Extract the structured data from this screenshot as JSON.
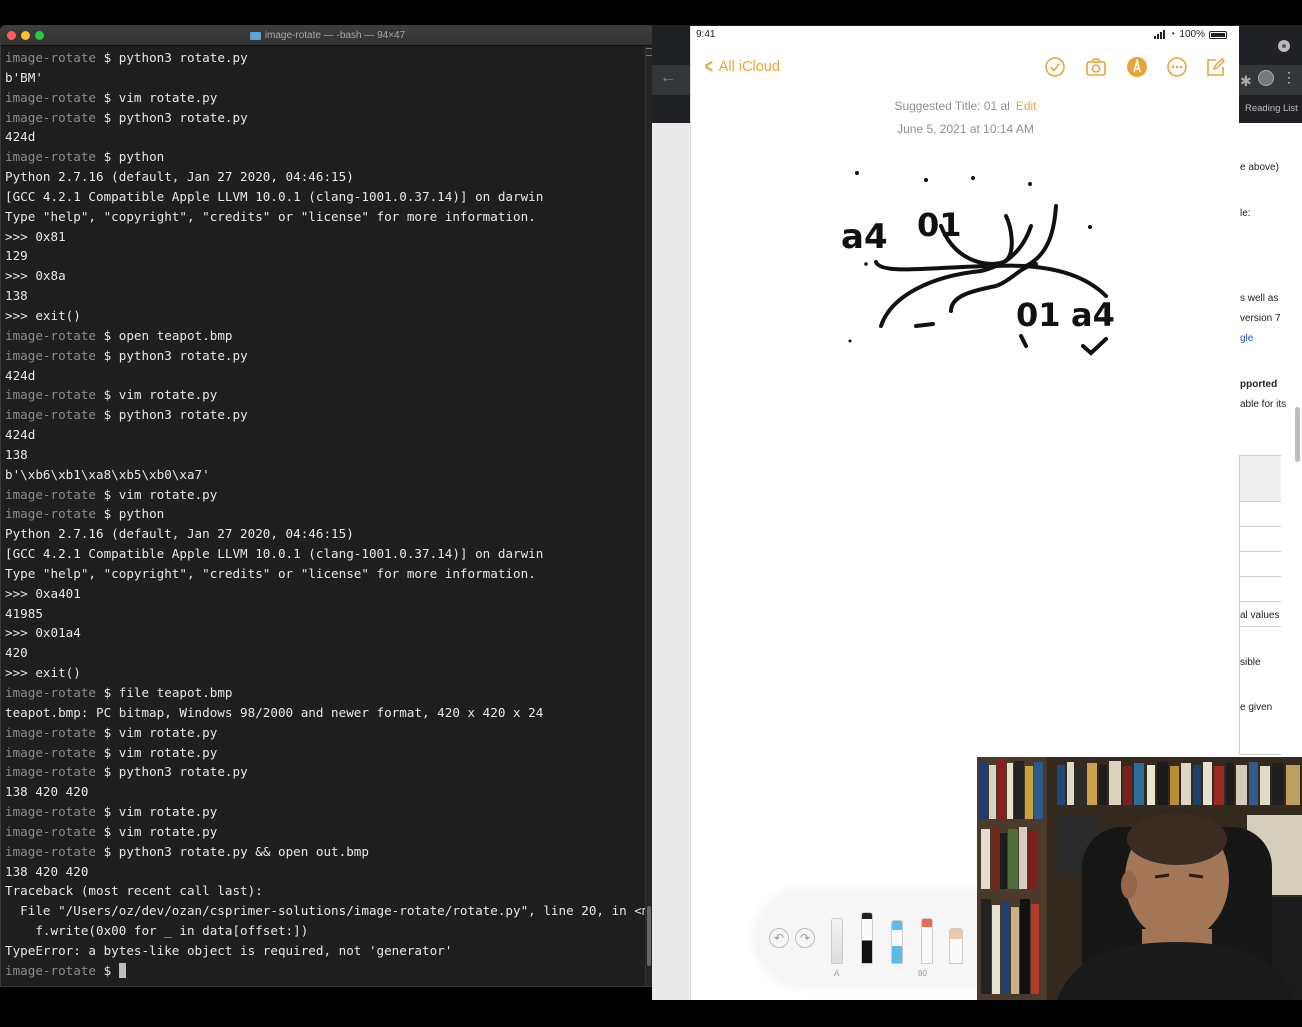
{
  "terminal": {
    "title": "image-rotate — -bash — 94×47",
    "lines": [
      {
        "p": "image-rotate",
        "c": "$ python3 rotate.py"
      },
      {
        "o": "b'BM'"
      },
      {
        "p": "image-rotate",
        "c": "$ vim rotate.py"
      },
      {
        "p": "image-rotate",
        "c": "$ python3 rotate.py"
      },
      {
        "o": "424d"
      },
      {
        "p": "image-rotate",
        "c": "$ python"
      },
      {
        "o": "Python 2.7.16 (default, Jan 27 2020, 04:46:15)"
      },
      {
        "o": "[GCC 4.2.1 Compatible Apple LLVM 10.0.1 (clang-1001.0.37.14)] on darwin"
      },
      {
        "o": "Type \"help\", \"copyright\", \"credits\" or \"license\" for more information."
      },
      {
        "o": ">>> 0x81"
      },
      {
        "o": "129"
      },
      {
        "o": ">>> 0x8a"
      },
      {
        "o": "138"
      },
      {
        "o": ">>> exit()"
      },
      {
        "p": "image-rotate",
        "c": "$ open teapot.bmp"
      },
      {
        "p": "image-rotate",
        "c": "$ python3 rotate.py"
      },
      {
        "o": "424d"
      },
      {
        "p": "image-rotate",
        "c": "$ vim rotate.py"
      },
      {
        "p": "image-rotate",
        "c": "$ python3 rotate.py"
      },
      {
        "o": "424d"
      },
      {
        "o": "138"
      },
      {
        "o": "b'\\xb6\\xb1\\xa8\\xb5\\xb0\\xa7'"
      },
      {
        "p": "image-rotate",
        "c": "$ vim rotate.py"
      },
      {
        "p": "image-rotate",
        "c": "$ python"
      },
      {
        "o": "Python 2.7.16 (default, Jan 27 2020, 04:46:15)"
      },
      {
        "o": "[GCC 4.2.1 Compatible Apple LLVM 10.0.1 (clang-1001.0.37.14)] on darwin"
      },
      {
        "o": "Type \"help\", \"copyright\", \"credits\" or \"license\" for more information."
      },
      {
        "o": ">>> 0xa401"
      },
      {
        "o": "41985"
      },
      {
        "o": ">>> 0x01a4"
      },
      {
        "o": "420"
      },
      {
        "o": ">>> exit()"
      },
      {
        "p": "image-rotate",
        "c": "$ file teapot.bmp"
      },
      {
        "o": "teapot.bmp: PC bitmap, Windows 98/2000 and newer format, 420 x 420 x 24"
      },
      {
        "p": "image-rotate",
        "c": "$ vim rotate.py"
      },
      {
        "p": "image-rotate",
        "c": "$ vim rotate.py"
      },
      {
        "p": "image-rotate",
        "c": "$ python3 rotate.py"
      },
      {
        "o": "138 420 420"
      },
      {
        "p": "image-rotate",
        "c": "$ vim rotate.py"
      },
      {
        "p": "image-rotate",
        "c": "$ vim rotate.py"
      },
      {
        "p": "image-rotate",
        "c": "$ python3 rotate.py && open out.bmp"
      },
      {
        "o": "138 420 420"
      },
      {
        "o": "Traceback (most recent call last):"
      },
      {
        "o": "  File \"/Users/oz/dev/ozan/csprimer-solutions/image-rotate/rotate.py\", line 20, in <module>"
      },
      {
        "o": "    f.write(0x00 for _ in data[offset:])"
      },
      {
        "o": "TypeError: a bytes-like object is required, not 'generator'"
      },
      {
        "p": "image-rotate",
        "c": "$ ",
        "cursor": true
      }
    ]
  },
  "notes": {
    "status_time": "9:41",
    "battery": "100%",
    "back_label": "All iCloud",
    "suggested_title_label": "Suggested Title: 01 al",
    "edit_label": "Edit",
    "date": "June 5, 2021 at 10:14 AM",
    "toolbar_icons": [
      "checklist-icon",
      "camera-icon",
      "markup-icon",
      "more-icon",
      "compose-icon"
    ],
    "handwriting": {
      "left_top": "a4",
      "right_top": "01",
      "left_bottom": "01",
      "right_bottom": "a4"
    },
    "tool_labels": {
      "pencil": "A",
      "marker": "80"
    }
  },
  "browser": {
    "reading_list": "Reading List",
    "fragments": [
      "e above)",
      "le:",
      "s well as",
      "version 7",
      "gle",
      "pported",
      "able for its",
      "al values",
      "sible",
      "e given"
    ]
  }
}
